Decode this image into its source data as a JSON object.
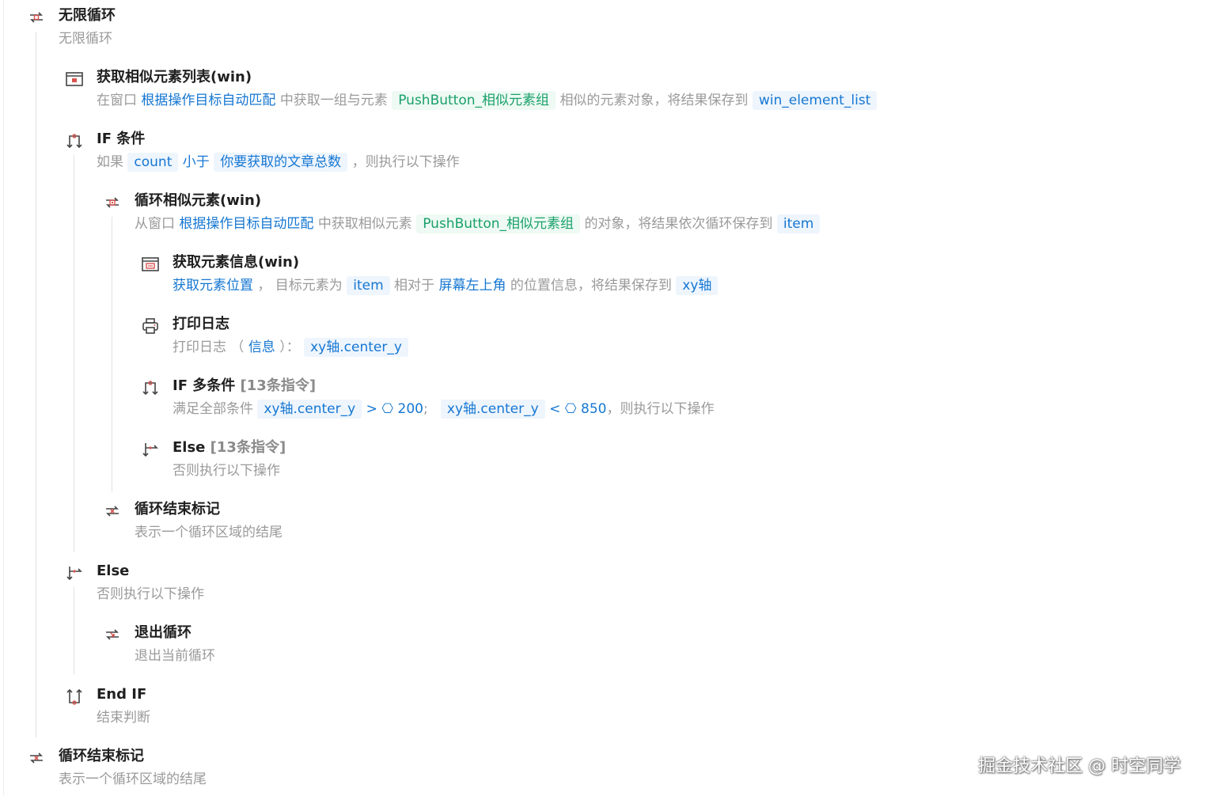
{
  "flow": {
    "s1": {
      "title": "无限循环",
      "desc": "无限循环"
    },
    "s2": {
      "title": "获取相似元素列表(win)",
      "d1": "在窗口",
      "window": "根据操作目标自动匹配",
      "d2": "中获取一组与元素",
      "element": "PushButton_相似元素组",
      "d3": "相似的元素对象，将结果保存到",
      "var": "win_element_list"
    },
    "s3": {
      "title": "IF 条件",
      "d1": "如果",
      "var": "count",
      "op": "小于",
      "value": "你要获取的文章总数",
      "d2": "，则执行以下操作"
    },
    "s4": {
      "title": "循环相似元素(win)",
      "d1": "从窗口",
      "window": "根据操作目标自动匹配",
      "d2": "中获取相似元素",
      "element": "PushButton_相似元素组",
      "d3": "的对象，将结果依次循环保存到",
      "var": "item"
    },
    "s5": {
      "title": "获取元素信息(win)",
      "action": "获取元素位置",
      "d1": "，  目标元素为",
      "target": "item",
      "d2": "相对于",
      "relative": "屏幕左上角",
      "d3": "的位置信息，将结果保存到",
      "var": "xy轴"
    },
    "s6": {
      "title": "打印日志",
      "d1": "打印日志 （",
      "info": "信息",
      "d2": "）：",
      "var": "xy轴.center_y"
    },
    "s7": {
      "title": "IF 多条件",
      "count": "[13条指令]",
      "d1": "满足全部条件",
      "var1": "xy轴.center_y",
      "op1": ">",
      "val1": "200",
      "sep": ";",
      "var2": "xy轴.center_y",
      "op2": "<",
      "val2": "850",
      "d2": "，则执行以下操作"
    },
    "s8": {
      "title": "Else",
      "count": "[13条指令]",
      "desc": "否则执行以下操作"
    },
    "s9": {
      "title": "循环结束标记",
      "desc": "表示一个循环区域的结尾"
    },
    "s10": {
      "title": "Else",
      "desc": "否则执行以下操作"
    },
    "s11": {
      "title": "退出循环",
      "desc": "退出当前循环"
    },
    "s12": {
      "title": "End IF",
      "desc": "结束判断"
    },
    "s13": {
      "title": "循环结束标记",
      "desc": "表示一个循环区域的结尾"
    }
  },
  "watermark": "掘金技术社区 @ 时空同学",
  "colors": {
    "link": "#1677d2",
    "element": "#1aa06a",
    "loop_icon": "#d9534f",
    "text_muted": "#9a9a9a"
  },
  "icons": [
    "loop-icon",
    "window-list-icon",
    "if-branch-icon",
    "loop-similar-icon",
    "element-info-icon",
    "printer-icon",
    "if-multi-icon",
    "else-icon",
    "loop-end-icon",
    "else-icon",
    "exit-loop-icon",
    "end-if-icon",
    "loop-end-icon"
  ]
}
